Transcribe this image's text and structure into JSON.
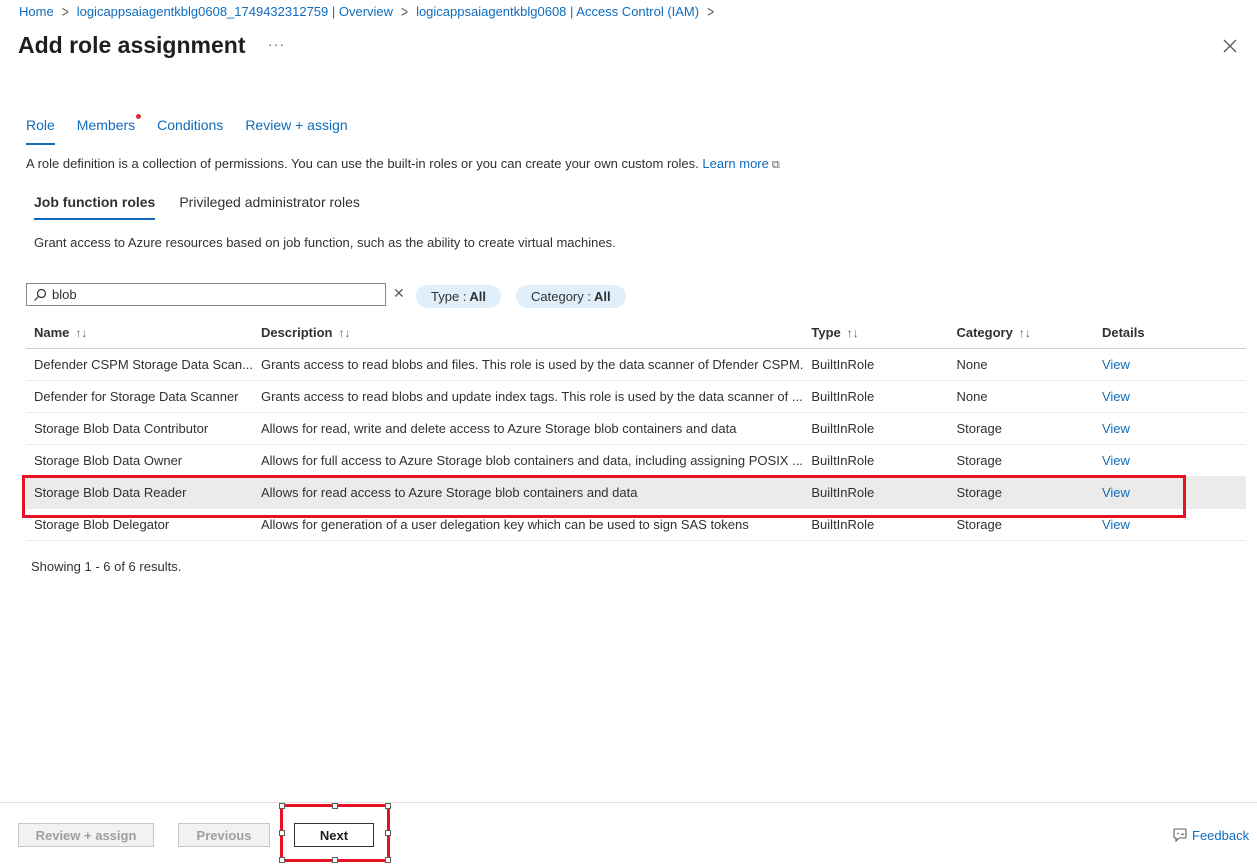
{
  "breadcrumb": {
    "items": [
      "Home",
      "logicappsaiagentkblg0608_1749432312759 | Overview",
      "logicappsaiagentkblg0608 | Access Control (IAM)"
    ]
  },
  "header": {
    "title": "Add role assignment",
    "more": "···"
  },
  "tabs": [
    {
      "label": "Role"
    },
    {
      "label": "Members"
    },
    {
      "label": "Conditions"
    },
    {
      "label": "Review + assign"
    }
  ],
  "description": {
    "text": "A role definition is a collection of permissions. You can use the built-in roles or you can create your own custom roles.",
    "link": "Learn more"
  },
  "subtabs": [
    {
      "label": "Job function roles"
    },
    {
      "label": "Privileged administrator roles"
    }
  ],
  "subdescription": "Grant access to Azure resources based on job function, such as the ability to create virtual machines.",
  "search": {
    "value": "blob"
  },
  "filters": {
    "type_label": "Type :",
    "type_value": "All",
    "category_label": "Category :",
    "category_value": "All"
  },
  "table": {
    "headers": [
      "Name",
      "Description",
      "Type",
      "Category",
      "Details"
    ],
    "rows": [
      [
        "Defender CSPM Storage Data Scan...",
        "Grants access to read blobs and files. This role is used by the data scanner of Dfender CSPM.",
        "BuiltInRole",
        "None",
        "View"
      ],
      [
        "Defender for Storage Data Scanner",
        "Grants access to read blobs and update index tags. This role is used by the data scanner of ...",
        "BuiltInRole",
        "None",
        "View"
      ],
      [
        "Storage Blob Data Contributor",
        "Allows for read, write and delete access to Azure Storage blob containers and data",
        "BuiltInRole",
        "Storage",
        "View"
      ],
      [
        "Storage Blob Data Owner",
        "Allows for full access to Azure Storage blob containers and data, including assigning POSIX ...",
        "BuiltInRole",
        "Storage",
        "View"
      ],
      [
        "Storage Blob Data Reader",
        "Allows for read access to Azure Storage blob containers and data",
        "BuiltInRole",
        "Storage",
        "View"
      ],
      [
        "Storage Blob Delegator",
        "Allows for generation of a user delegation key which can be used to sign SAS tokens",
        "BuiltInRole",
        "Storage",
        "View"
      ]
    ],
    "selected_row": 4
  },
  "results": "Showing 1 - 6 of 6 results.",
  "footer": {
    "review_assign": "Review + assign",
    "previous": "Previous",
    "next": "Next",
    "feedback": "Feedback"
  },
  "colors": {
    "accent": "#0f6cbd",
    "highlight": "#e81123",
    "pill": "#e1effa"
  }
}
